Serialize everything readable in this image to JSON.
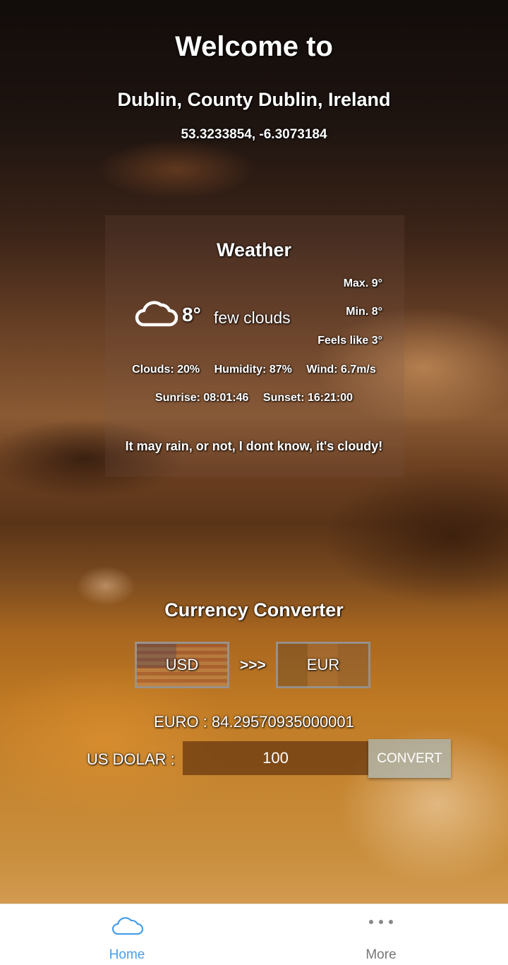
{
  "header": {
    "welcome": "Welcome to",
    "location": "Dublin, County Dublin, Ireland",
    "coordinates": "53.3233854, -6.3073184"
  },
  "weather": {
    "title": "Weather",
    "icon": "cloud-icon",
    "temperature": "8°",
    "description": "few clouds",
    "max": "Max. 9°",
    "min": "Min. 8°",
    "feels_like": "Feels like 3°",
    "clouds": "Clouds: 20%",
    "humidity": "Humidity: 87%",
    "wind": "Wind: 6.7m/s",
    "sunrise": "Sunrise: 08:01:46",
    "sunset": "Sunset: 16:21:00",
    "message": "It may rain, or not, I dont know, it's cloudy!"
  },
  "converter": {
    "title": "Currency Converter",
    "from_currency": "USD",
    "arrows": ">>>",
    "to_currency": "EUR",
    "result": "EURO : 84.29570935000001",
    "input_label": "US DOLAR :",
    "input_value": "100",
    "convert_label": "CONVERT"
  },
  "nav": {
    "home_label": "Home",
    "home_icon": "cloud-icon",
    "more_label": "More",
    "more_icon": "more-dots-icon",
    "active_color": "#4a9ee8",
    "inactive_color": "#777777"
  }
}
